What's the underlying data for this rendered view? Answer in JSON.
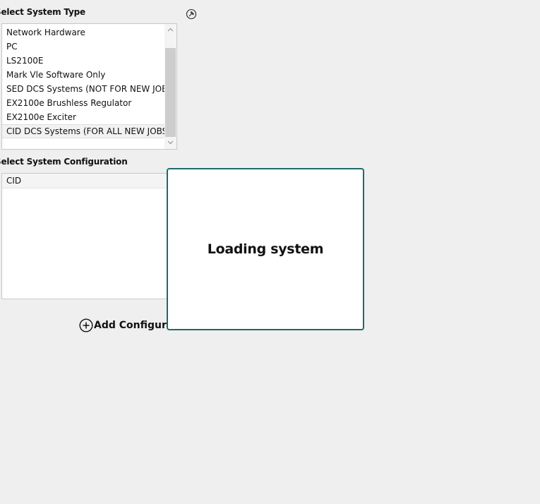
{
  "system_type": {
    "title": "Select System Type",
    "items": [
      "Network Hardware",
      "PC",
      "LS2100E",
      "Mark Vle Software Only",
      "SED DCS Systems (NOT FOR NEW JOBS)",
      "EX2100e Brushless Regulator",
      "EX2100e Exciter",
      "CID DCS Systems (FOR ALL NEW JOBS)"
    ],
    "selected_index": 7
  },
  "system_configuration": {
    "title": "Select System Configuration",
    "rows": [
      "CID"
    ]
  },
  "add_configuration": {
    "label": "Add Configuration"
  },
  "loading": {
    "text": "Loading system"
  },
  "colors": {
    "background": "#efefef",
    "modal_border": "#1d6b68",
    "selected_row": "#f2f2f2"
  },
  "icons": {
    "pin": "pin-icon",
    "add": "plus-circle-icon",
    "scroll_up": "chevron-up-icon",
    "scroll_down": "chevron-down-icon"
  }
}
